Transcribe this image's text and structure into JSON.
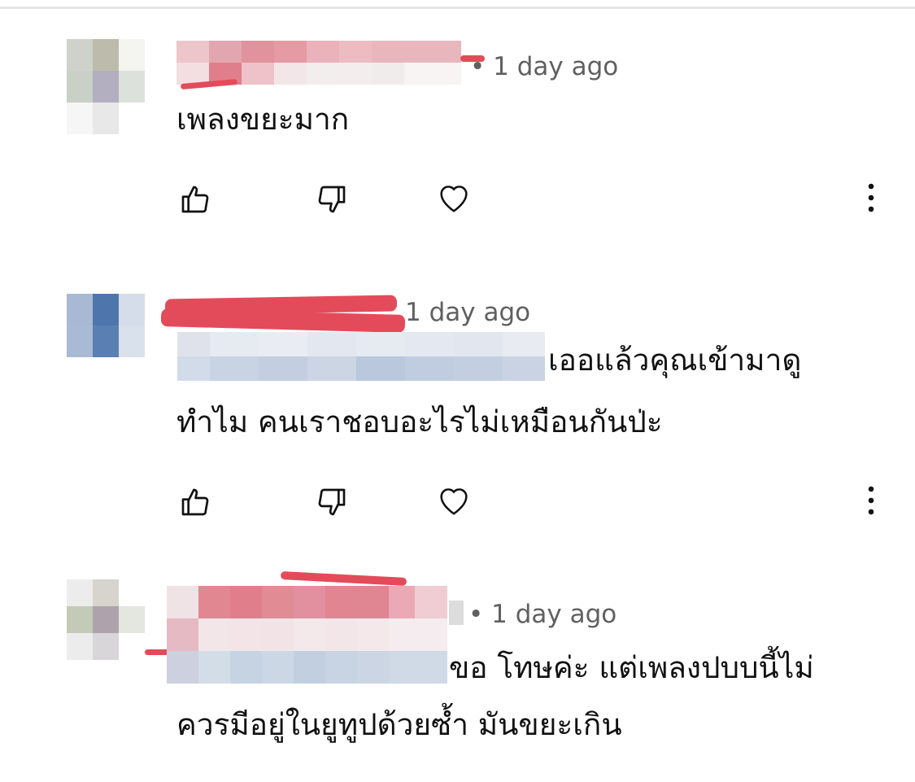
{
  "comments": [
    {
      "time": "• 1 day ago",
      "text": "เพลงขยะมาก"
    },
    {
      "time": "1 day ago",
      "text_line1": "เออแล้วคุณเข้ามาดู",
      "text_line2": "ทำไม คนเราชอบอะไรไม่เหมือนกันป่ะ"
    },
    {
      "time": "• 1 day ago",
      "text_line1": "ขอ โทษค่ะ แต่เพลงปบบนี้ไม่",
      "text_line2": "ควรมีอยู่ในยูทูปด้วยซ้ำ มันขยะเกิน"
    }
  ],
  "icons": {
    "like": "thumb-up-icon",
    "dislike": "thumb-down-icon",
    "heart": "heart-icon",
    "more": "more-vert-icon"
  },
  "colors": {
    "redaction_red": "#e34b5a",
    "meta_gray": "#606060",
    "text": "#111111"
  }
}
